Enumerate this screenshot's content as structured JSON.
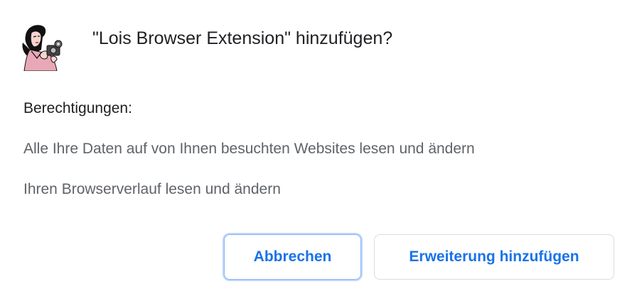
{
  "dialog": {
    "title": "\"Lois Browser Extension\" hinzufügen?",
    "icon": "extension-logo-icon",
    "permissions_heading": "Berechtigungen:",
    "permissions": [
      "Alle Ihre Daten auf von Ihnen besuchten Websites lesen und ändern",
      "Ihren Browserverlauf lesen und ändern"
    ],
    "buttons": {
      "cancel_label": "Abbrechen",
      "add_label": "Erweiterung hinzufügen"
    }
  },
  "colors": {
    "title_text": "#202124",
    "secondary_text": "#5f6368",
    "accent": "#1a73e8",
    "focus_ring": "#8ab4f8",
    "button_border": "#dadce0"
  }
}
